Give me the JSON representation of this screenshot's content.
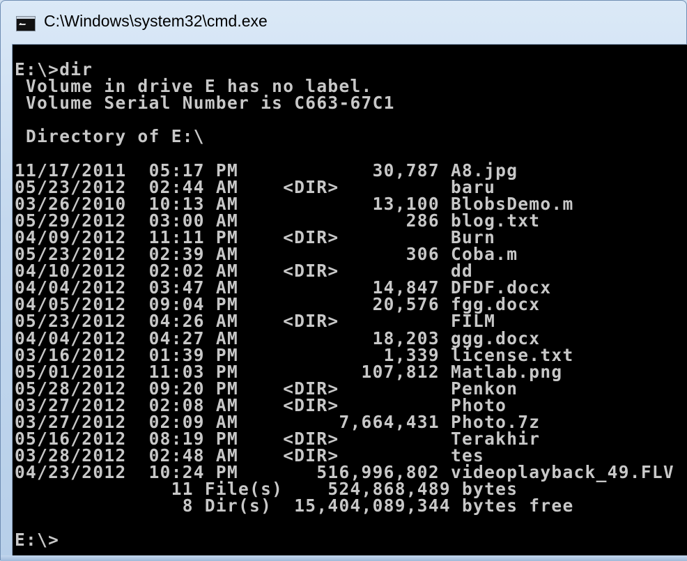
{
  "window": {
    "title": "C:\\Windows\\system32\\cmd.exe",
    "icon": "cmd-icon"
  },
  "console": {
    "lines": [
      "E:\\>dir",
      " Volume in drive E has no label.",
      " Volume Serial Number is C663-67C1",
      "",
      " Directory of E:\\",
      "",
      "11/17/2011  05:17 PM            30,787 A8.jpg",
      "05/23/2012  02:44 AM    <DIR>          baru",
      "03/26/2010  10:13 AM            13,100 BlobsDemo.m",
      "05/29/2012  03:00 AM               286 blog.txt",
      "04/09/2012  11:11 PM    <DIR>          Burn",
      "05/23/2012  02:39 AM               306 Coba.m",
      "04/10/2012  02:02 AM    <DIR>          dd",
      "04/04/2012  03:47 AM            14,847 DFDF.docx",
      "04/05/2012  09:04 PM            20,576 fgg.docx",
      "05/23/2012  04:26 AM    <DIR>          FILM",
      "04/04/2012  04:27 AM            18,203 ggg.docx",
      "03/16/2012  01:39 PM             1,339 license.txt",
      "05/01/2012  11:03 PM           107,812 Matlab.png",
      "05/28/2012  09:20 PM    <DIR>          Penkon",
      "03/27/2012  02:08 AM    <DIR>          Photo",
      "03/27/2012  02:09 AM         7,664,431 Photo.7z",
      "05/16/2012  08:19 PM    <DIR>          Terakhir",
      "03/28/2012  02:48 AM    <DIR>          tes",
      "04/23/2012  10:24 PM       516,996,802 videoplayback_49.FLV",
      "              11 File(s)    524,868,489 bytes",
      "               8 Dir(s)  15,404,089,344 bytes free",
      "",
      "E:\\>"
    ]
  }
}
